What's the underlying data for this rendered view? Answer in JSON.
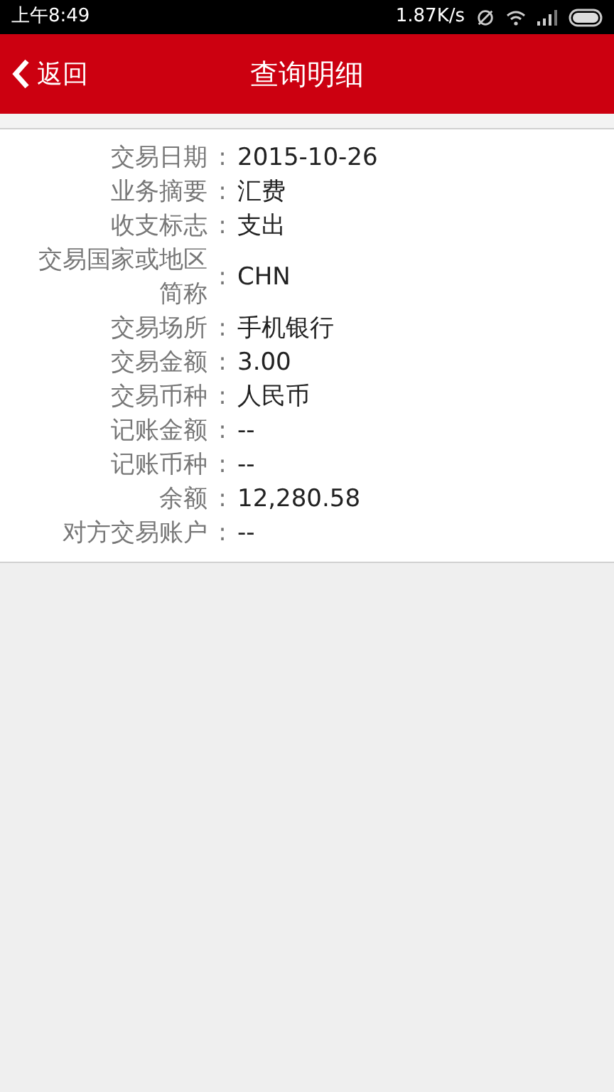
{
  "status_bar": {
    "time": "上午8:49",
    "speed": "1.87K/s"
  },
  "header": {
    "back": "返回",
    "title": "查询明细"
  },
  "details": [
    {
      "label": "交易日期",
      "colon": ":",
      "value": "2015-10-26"
    },
    {
      "label": "业务摘要",
      "colon": ":",
      "value": "汇费"
    },
    {
      "label": "收支标志",
      "colon": ":",
      "value": "支出"
    },
    {
      "label": "交易国家或地区简称",
      "colon": ":",
      "value": "CHN"
    },
    {
      "label": "交易场所",
      "colon": ":",
      "value": "手机银行"
    },
    {
      "label": "交易金额",
      "colon": ":",
      "value": "3.00"
    },
    {
      "label": "交易币种",
      "colon": ":",
      "value": "人民币"
    },
    {
      "label": "记账金额",
      "colon": ":",
      "value": "--"
    },
    {
      "label": "记账币种",
      "colon": ":",
      "value": "--"
    },
    {
      "label": "余额",
      "colon": ":",
      "value": "12,280.58"
    },
    {
      "label": "对方交易账户",
      "colon": ":",
      "value": "--"
    }
  ]
}
